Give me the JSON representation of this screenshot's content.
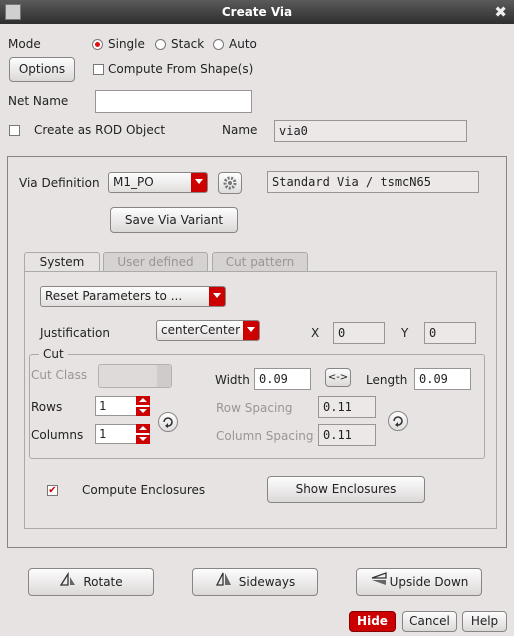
{
  "window": {
    "title": "Create Via",
    "close_glyph": "✖"
  },
  "mode": {
    "label": "Mode",
    "options": [
      "Single",
      "Stack",
      "Auto"
    ],
    "selected": "Single"
  },
  "options_button": "Options",
  "compute_from_shapes": {
    "label": "Compute From Shape(s)",
    "checked": false
  },
  "net_name": {
    "label": "Net Name",
    "value": ""
  },
  "rod": {
    "label": "Create as ROD Object",
    "checked": false
  },
  "name": {
    "label": "Name",
    "value": "via0"
  },
  "via_definition": {
    "label": "Via Definition",
    "value": "M1_PO",
    "description": "Standard Via / tsmcN65"
  },
  "save_variant": "Save Via Variant",
  "tabs": [
    {
      "label": "System",
      "active": true
    },
    {
      "label": "User defined",
      "active": false
    },
    {
      "label": "Cut pattern",
      "active": false
    }
  ],
  "reset_params": "Reset Parameters to ...",
  "justification": {
    "label": "Justification",
    "value": "centerCenter"
  },
  "x": {
    "label": "X",
    "value": "0"
  },
  "y": {
    "label": "Y",
    "value": "0"
  },
  "cut": {
    "group_label": "Cut",
    "cut_class_label": "Cut Class",
    "cut_class_value": "",
    "width_label": "Width",
    "width_value": "0.09",
    "swap_label": "<->",
    "length_label": "Length",
    "length_value": "0.09",
    "rows_label": "Rows",
    "rows_value": "1",
    "columns_label": "Columns",
    "columns_value": "1",
    "row_spacing_label": "Row Spacing",
    "row_spacing_value": "0.11",
    "column_spacing_label": "Column Spacing",
    "column_spacing_value": "0.11"
  },
  "compute_enclosures": {
    "label": "Compute Enclosures",
    "checked": true,
    "check_glyph": "✔"
  },
  "show_enclosures": "Show Enclosures",
  "actions": {
    "rotate": "Rotate",
    "sideways": "Sideways",
    "upside_down": "Upside Down"
  },
  "footer": {
    "hide": "Hide",
    "cancel": "Cancel",
    "help": "Help"
  },
  "colors": {
    "accent": "#cc0000",
    "background": "#e8e3e3",
    "titlebar": "#3a3a3a"
  }
}
